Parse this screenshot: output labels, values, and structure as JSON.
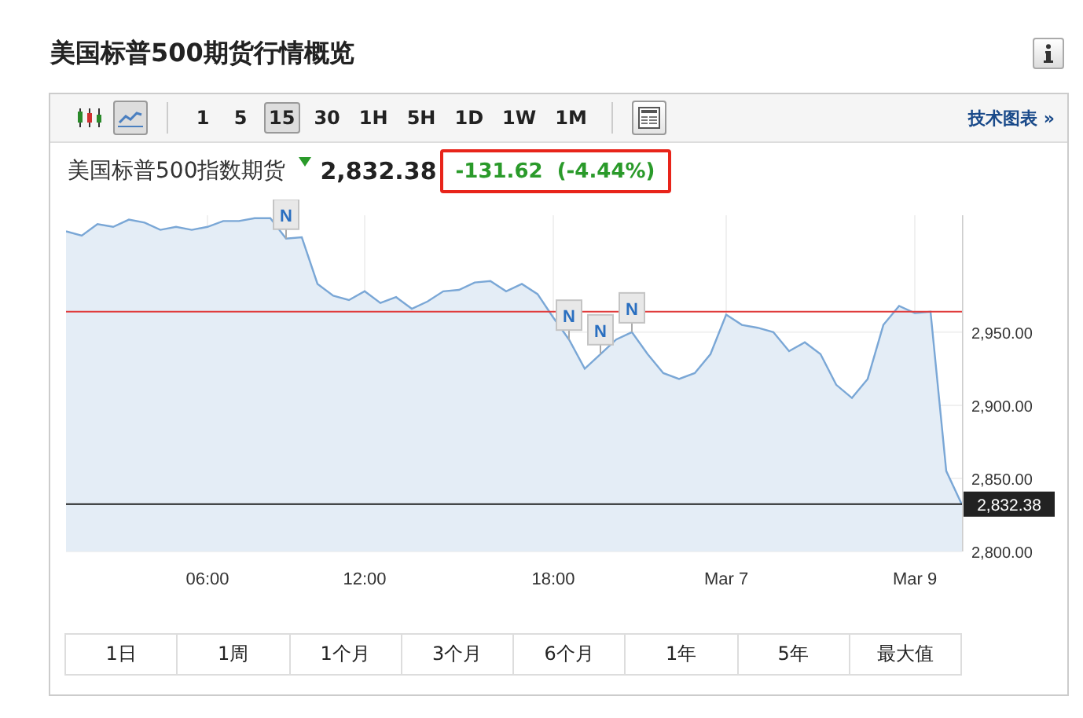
{
  "title": "美国标普500期货行情概览",
  "toolbar": {
    "chart_types": [
      {
        "kind": "candles",
        "selected": false
      },
      {
        "kind": "line",
        "selected": true
      }
    ],
    "intervals": [
      {
        "label": "1",
        "selected": false
      },
      {
        "label": "5",
        "selected": false
      },
      {
        "label": "15",
        "selected": true
      },
      {
        "label": "30",
        "selected": false
      },
      {
        "label": "1H",
        "selected": false
      },
      {
        "label": "5H",
        "selected": false
      },
      {
        "label": "1D",
        "selected": false
      },
      {
        "label": "1W",
        "selected": false
      },
      {
        "label": "1M",
        "selected": false
      }
    ],
    "technical_link": "技术图表 »"
  },
  "quote": {
    "name": "美国标普500指数期货",
    "falling": true,
    "price": "2,832.38",
    "change": "-131.62",
    "change_percent": "(-4.44%)",
    "highlighted": true
  },
  "chart": {
    "chart_data": {
      "type": "area",
      "grid": true,
      "categories": [
        null,
        null,
        null,
        null,
        null,
        null,
        null,
        null,
        null,
        "06:00",
        null,
        null,
        null,
        null,
        null,
        null,
        null,
        null,
        null,
        "12:00",
        null,
        null,
        null,
        null,
        null,
        null,
        null,
        null,
        null,
        null,
        null,
        "18:00",
        null,
        null,
        null,
        null,
        null,
        null,
        null,
        null,
        null,
        null,
        "Mar 7",
        null,
        null,
        null,
        null,
        null,
        null,
        null,
        null,
        null,
        null,
        null,
        "Mar 9",
        null,
        null,
        null
      ],
      "values": [
        3019,
        3016,
        3024,
        3022,
        3027,
        3025,
        3020,
        3022,
        3020,
        3022,
        3026,
        3026,
        3028,
        3028,
        3014,
        3015,
        2983,
        2975,
        2972,
        2978,
        2970,
        2974,
        2966,
        2971,
        2978,
        2979,
        2984,
        2985,
        2978,
        2983,
        2976,
        2960,
        2945,
        2925,
        2935,
        2945,
        2950,
        2935,
        2922,
        2918,
        2922,
        2935,
        2962,
        2955,
        2953,
        2950,
        2937,
        2943,
        2935,
        2914,
        2905,
        2918,
        2955,
        2968,
        2963,
        2964,
        2855,
        2832
      ],
      "ylim": [
        2800,
        3030
      ],
      "yticks": [
        {
          "value": 2800,
          "label": "2,800.00"
        },
        {
          "value": 2850,
          "label": "2,850.00"
        },
        {
          "value": 2900,
          "label": "2,900.00"
        },
        {
          "value": 2950,
          "label": "2,950.00"
        }
      ],
      "ref_lines": [
        {
          "axis": "y",
          "value": 2964,
          "color": "#e03c3c"
        },
        {
          "axis": "y",
          "value": 2832.38,
          "color": "#222222",
          "label": "2,832.38"
        }
      ],
      "annotations": [
        {
          "text": "N"
        },
        {
          "text": "N"
        },
        {
          "text": "N"
        },
        {
          "text": "N"
        }
      ]
    }
  },
  "ranges": [
    {
      "label": "1日",
      "selected": false
    },
    {
      "label": "1周",
      "selected": false
    },
    {
      "label": "1个月",
      "selected": false
    },
    {
      "label": "3个月",
      "selected": false
    },
    {
      "label": "6个月",
      "selected": false
    },
    {
      "label": "1年",
      "selected": false
    },
    {
      "label": "5年",
      "selected": false
    },
    {
      "label": "最大值",
      "selected": false
    }
  ]
}
